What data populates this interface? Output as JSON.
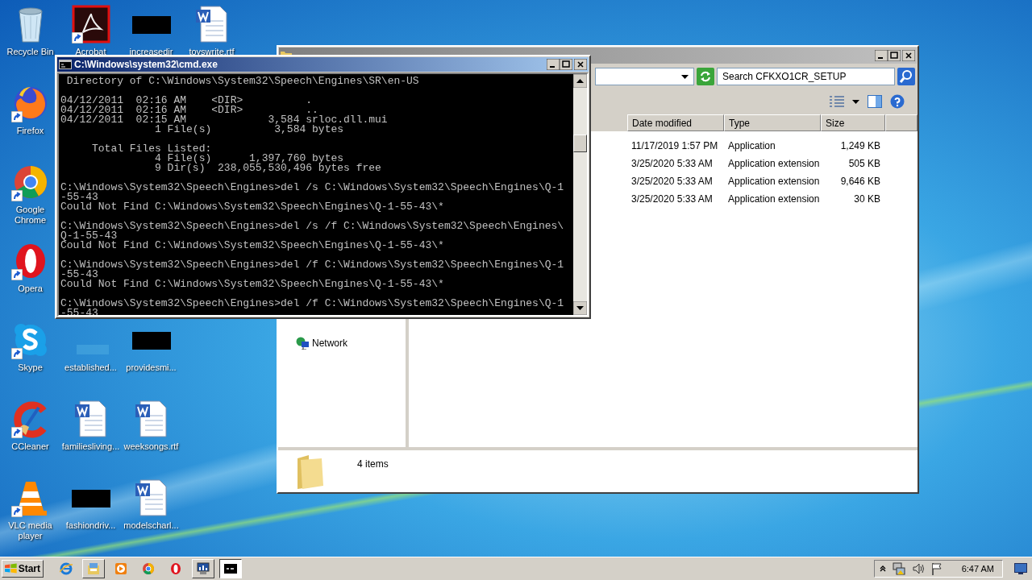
{
  "desktop": {
    "icons": [
      {
        "label": "Recycle Bin",
        "kind": "recycle-bin",
        "shortcut": false
      },
      {
        "label": "Acrobat",
        "kind": "acrobat",
        "shortcut": true
      },
      {
        "label": "increasedir",
        "kind": "redacted",
        "shortcut": false
      },
      {
        "label": "toyswrite.rtf",
        "kind": "word-doc",
        "shortcut": false
      },
      {
        "label": "Firefox",
        "kind": "firefox",
        "shortcut": true
      },
      {
        "label": "Google Chrome",
        "kind": "chrome",
        "shortcut": true
      },
      {
        "label": "Opera",
        "kind": "opera",
        "shortcut": true
      },
      {
        "label": "Skype",
        "kind": "skype",
        "shortcut": true
      },
      {
        "label": "established...",
        "kind": "blank",
        "shortcut": false
      },
      {
        "label": "providesmi...",
        "kind": "redacted",
        "shortcut": false
      },
      {
        "label": "CCleaner",
        "kind": "ccleaner",
        "shortcut": true
      },
      {
        "label": "familiesliving...",
        "kind": "word-doc",
        "shortcut": false
      },
      {
        "label": "weeksongs.rtf",
        "kind": "word-doc",
        "shortcut": false
      },
      {
        "label": "VLC media player",
        "kind": "vlc",
        "shortcut": true
      },
      {
        "label": "fashiondriv...",
        "kind": "redacted",
        "shortcut": false
      },
      {
        "label": "modelscharl...",
        "kind": "word-doc",
        "shortcut": false
      }
    ]
  },
  "explorer": {
    "search": {
      "placeholder": "Search CFKXO1CR_SETUP"
    },
    "columns": [
      "Date modified",
      "Type",
      "Size"
    ],
    "rows": [
      {
        "date_modified": "11/17/2019 1:57 PM",
        "type": "Application",
        "size": "1,249 KB"
      },
      {
        "date_modified": "3/25/2020 5:33 AM",
        "type": "Application extension",
        "size": "505 KB"
      },
      {
        "date_modified": "3/25/2020 5:33 AM",
        "type": "Application extension",
        "size": "9,646 KB"
      },
      {
        "date_modified": "3/25/2020 5:33 AM",
        "type": "Application extension",
        "size": "30 KB"
      }
    ],
    "navigation": [
      {
        "label": "Network"
      }
    ],
    "status": "4 items"
  },
  "console": {
    "title": "C:\\Windows\\system32\\cmd.exe",
    "blocks": [
      [
        " Directory of C:\\Windows\\System32\\Speech\\Engines\\SR\\en-US"
      ],
      [
        "04/12/2011  02:16 AM    <DIR>          .",
        "04/12/2011  02:16 AM    <DIR>          ..",
        "04/12/2011  02:15 AM             3,584 srloc.dll.mui",
        "               1 File(s)          3,584 bytes"
      ],
      [
        "     Total Files Listed:",
        "               4 File(s)      1,397,760 bytes",
        "               9 Dir(s)  238,055,530,496 bytes free"
      ],
      [
        "C:\\Windows\\System32\\Speech\\Engines>del /s C:\\Windows\\System32\\Speech\\Engines\\Q-1",
        "-55-43",
        "Could Not Find C:\\Windows\\System32\\Speech\\Engines\\Q-1-55-43\\*"
      ],
      [
        "C:\\Windows\\System32\\Speech\\Engines>del /s /f C:\\Windows\\System32\\Speech\\Engines\\",
        "Q-1-55-43",
        "Could Not Find C:\\Windows\\System32\\Speech\\Engines\\Q-1-55-43\\*"
      ],
      [
        "C:\\Windows\\System32\\Speech\\Engines>del /f C:\\Windows\\System32\\Speech\\Engines\\Q-1",
        "-55-43",
        "Could Not Find C:\\Windows\\System32\\Speech\\Engines\\Q-1-55-43\\*"
      ],
      [
        "C:\\Windows\\System32\\Speech\\Engines>del /f C:\\Windows\\System32\\Speech\\Engines\\Q-1",
        "-55-43"
      ]
    ]
  },
  "taskbar": {
    "start": "Start",
    "buttons": [
      {
        "kind": "ie",
        "running": false,
        "selected": false
      },
      {
        "kind": "explorer",
        "running": true,
        "selected": false
      },
      {
        "kind": "media",
        "running": false,
        "selected": false
      },
      {
        "kind": "chrome",
        "running": false,
        "selected": false
      },
      {
        "kind": "opera",
        "running": false,
        "selected": false
      },
      {
        "kind": "taskmgr",
        "running": true,
        "selected": false
      },
      {
        "kind": "cmd",
        "running": true,
        "selected": true
      }
    ],
    "clock": "6:47 AM"
  }
}
